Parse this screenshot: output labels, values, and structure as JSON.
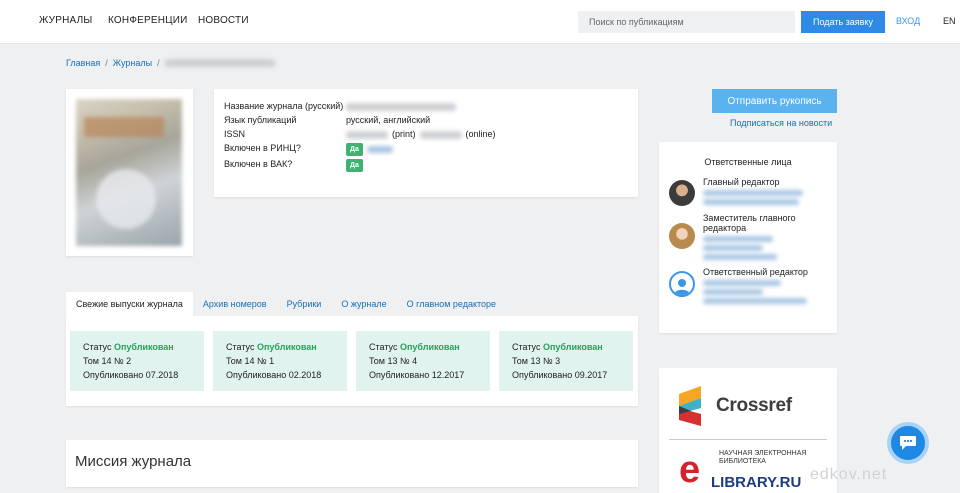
{
  "topnav": {
    "items": [
      "ЖУРНАЛЫ",
      "КОНФЕРЕНЦИИ",
      "НОВОСТИ"
    ],
    "search_placeholder": "Поиск по публикациям",
    "request_button": "Подать заявку",
    "login": "ВХОД",
    "lang": "EN"
  },
  "breadcrumb": {
    "home": "Главная",
    "journals": "Журналы",
    "sep": "/"
  },
  "info": {
    "rows": [
      {
        "label": "Название журнала (русский)"
      },
      {
        "label": "Язык публикаций",
        "value": "русский, английский"
      },
      {
        "label": "ISSN",
        "print": "(print)",
        "online": "(online)"
      },
      {
        "label": "Включен в РИНЦ?",
        "badge": "Да"
      },
      {
        "label": "Включен в ВАК?",
        "badge": "Да"
      }
    ]
  },
  "sidebar": {
    "submit_button": "Отправить рукопись",
    "subscribe_link": "Подписаться на новости",
    "persons_title": "Ответственные лица",
    "persons": [
      {
        "role": "Главный редактор"
      },
      {
        "role": "Заместитель главного редактора"
      },
      {
        "role": "Ответственный редактор"
      }
    ]
  },
  "tabs": [
    "Свежие выпуски журнала",
    "Архив номеров",
    "Рубрики",
    "О журнале",
    "О главном редакторе"
  ],
  "issues": [
    {
      "status_label": "Статус",
      "status": "Опубликован",
      "volume": "Том 14 № 2",
      "published": "Опубликовано 07.2018"
    },
    {
      "status_label": "Статус",
      "status": "Опубликован",
      "volume": "Том 14 № 1",
      "published": "Опубликовано 02.2018"
    },
    {
      "status_label": "Статус",
      "status": "Опубликован",
      "volume": "Том 13 № 4",
      "published": "Опубликовано 12.2017"
    },
    {
      "status_label": "Статус",
      "status": "Опубликован",
      "volume": "Том 13 № 3",
      "published": "Опубликовано 09.2017"
    }
  ],
  "mission": {
    "title": "Миссия журнала"
  },
  "logos": {
    "crossref": "Crossref",
    "elibrary_caption": "НАУЧНАЯ ЭЛЕКТРОННАЯ БИБЛИОТЕКА",
    "elibrary_name": "LIBRARY.RU",
    "elibrary_e": "e"
  },
  "colors": {
    "accent": "#2d8ae6",
    "published": "#27a25b",
    "issue_bg": "#e0f3ee"
  },
  "watermark": "edkov.net"
}
